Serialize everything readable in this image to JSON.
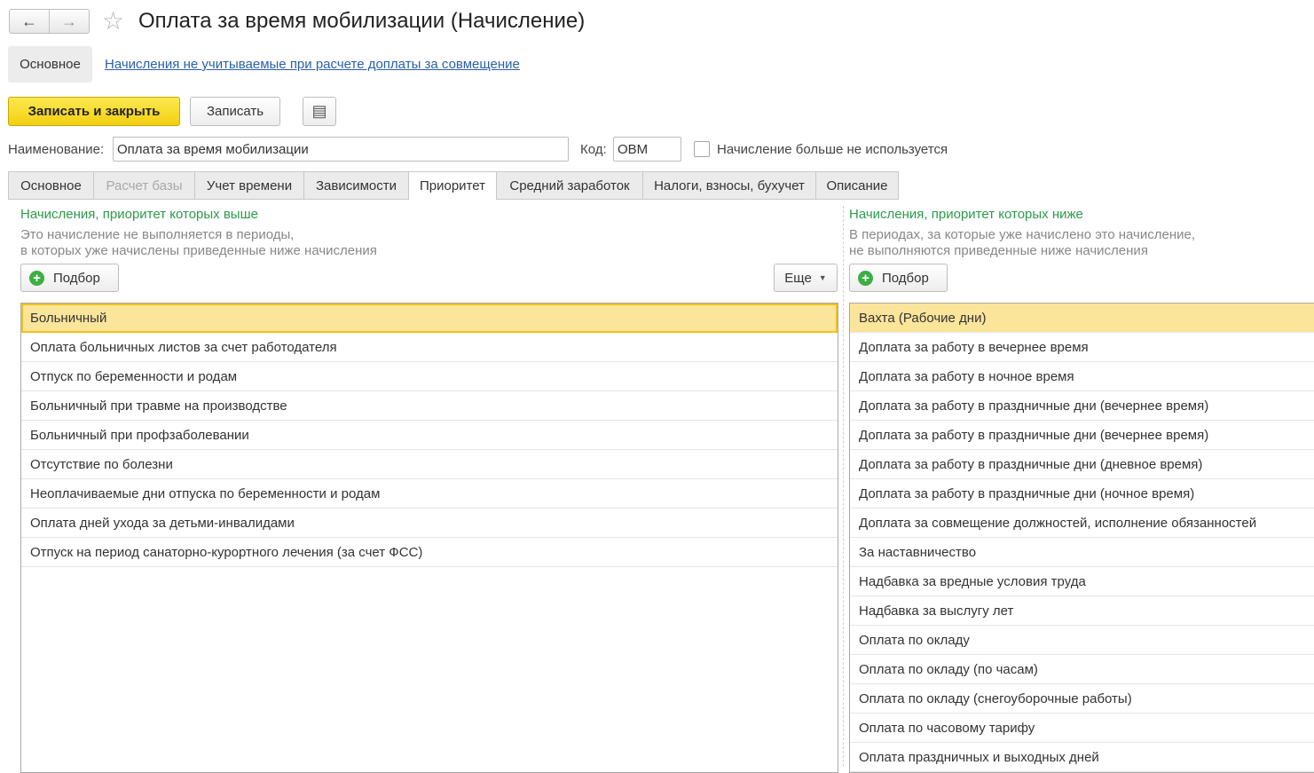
{
  "window": {
    "title": "Оплата за время мобилизации (Начисление)",
    "back_label": "←",
    "forward_label": "→",
    "star_glyph": "☆"
  },
  "sections": {
    "main_label": "Основное",
    "link_label": "Начисления не учитываемые при расчете доплаты за совмещение"
  },
  "toolbar": {
    "save_close_label": "Записать и закрыть",
    "save_label": "Записать",
    "more_glyph": "▤"
  },
  "form": {
    "name_label": "Наименование:",
    "name_value": "Оплата за время мобилизации",
    "code_label": "Код:",
    "code_value": "ОВМ",
    "not_used_label": "Начисление больше не используется",
    "not_used_checked": false
  },
  "tabs": [
    {
      "label": "Основное",
      "state": "normal"
    },
    {
      "label": "Расчет базы",
      "state": "disabled"
    },
    {
      "label": "Учет времени",
      "state": "normal"
    },
    {
      "label": "Зависимости",
      "state": "normal"
    },
    {
      "label": "Приоритет",
      "state": "active"
    },
    {
      "label": "Средний заработок",
      "state": "normal"
    },
    {
      "label": "Налоги, взносы, бухучет",
      "state": "normal"
    },
    {
      "label": "Описание",
      "state": "normal"
    }
  ],
  "left_panel": {
    "title": "Начисления, приоритет которых выше",
    "desc_line1": "Это начисление не выполняется в периоды,",
    "desc_line2": "в которых уже начислены приведенные ниже начисления",
    "podbor_label": "Подбор",
    "more_label": "Еще",
    "items": [
      "Больничный",
      "Оплата больничных листов за счет работодателя",
      "Отпуск по беременности и родам",
      "Больничный при травме на производстве",
      "Больничный при профзаболевании",
      "Отсутствие по болезни",
      "Неоплачиваемые дни отпуска по беременности и родам",
      "Оплата дней ухода за детьми-инвалидами",
      "Отпуск на период санаторно-курортного лечения (за счет ФСС)"
    ],
    "selected_index": 0
  },
  "right_panel": {
    "title": "Начисления, приоритет которых ниже",
    "desc_line1": "В периодах, за которые уже начислено это начисление,",
    "desc_line2": "не выполняются приведенные ниже начисления",
    "podbor_label": "Подбор",
    "items": [
      "Вахта (Рабочие дни)",
      "Доплата за работу в вечернее время",
      "Доплата за работу в ночное время",
      "Доплата за работу в праздничные дни (вечернее время)",
      "Доплата за работу в праздничные дни (вечернее время)",
      "Доплата за работу в праздничные дни (дневное время)",
      "Доплата за работу в праздничные дни (ночное время)",
      "Доплата за совмещение должностей, исполнение обязанностей",
      "За наставничество",
      "Надбавка за вредные условия труда",
      "Надбавка за выслугу лет",
      "Оплата по окладу",
      "Оплата по окладу (по часам)",
      "Оплата по окладу (снегоуборочные работы)",
      "Оплата по часовому тарифу",
      "Оплата праздничных и выходных дней"
    ],
    "selected_index": 0
  },
  "colors": {
    "accent_yellow": "#f4cf12",
    "selection": "#fbe59a",
    "panel_title_green": "#2c9a4b",
    "link_blue": "#2a5fa8",
    "plus_green": "#3eae45"
  }
}
